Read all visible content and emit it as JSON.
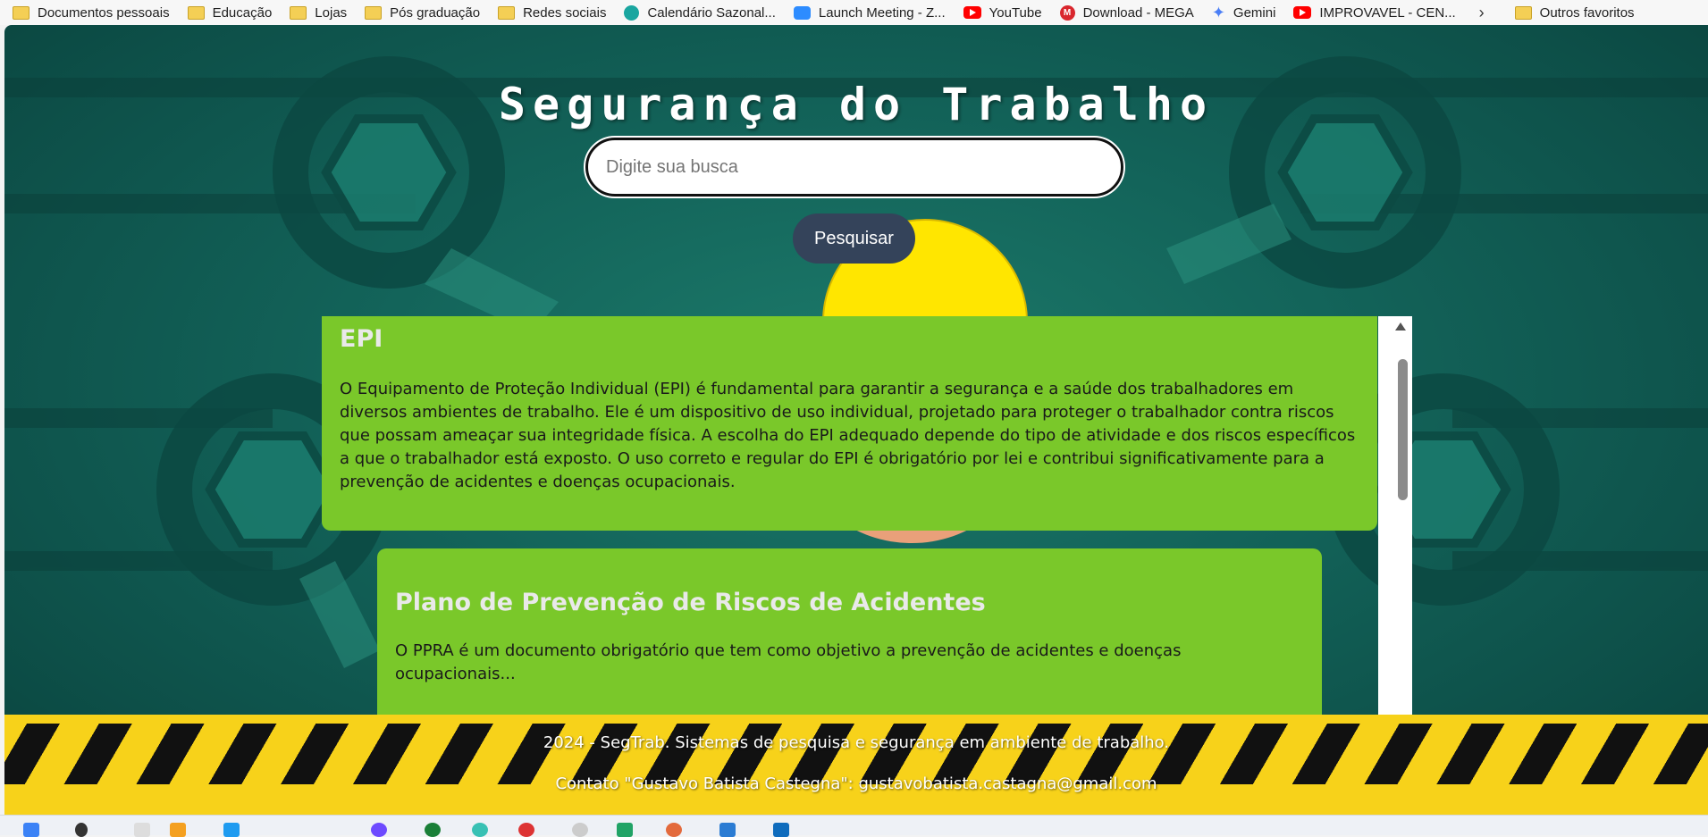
{
  "bookmarks": [
    {
      "label": "Documentos pessoais",
      "icon": "folder-icon"
    },
    {
      "label": "Educação",
      "icon": "folder-icon"
    },
    {
      "label": "Lojas",
      "icon": "folder-icon"
    },
    {
      "label": "Pós graduação",
      "icon": "folder-icon"
    },
    {
      "label": "Redes sociais",
      "icon": "folder-icon"
    },
    {
      "label": "Calendário Sazonal...",
      "icon": "calendar-icon"
    },
    {
      "label": "Launch Meeting - Z...",
      "icon": "zoom-icon"
    },
    {
      "label": "YouTube",
      "icon": "youtube-icon"
    },
    {
      "label": "Download - MEGA",
      "icon": "mega-icon"
    },
    {
      "label": "Gemini",
      "icon": "gemini-icon"
    },
    {
      "label": "IMPROVAVEL - CEN...",
      "icon": "youtube-icon"
    }
  ],
  "bookmarks_more": "Outros favoritos",
  "page": {
    "title": "Segurança do Trabalho",
    "search_placeholder": "Digite sua busca",
    "search_button": "Pesquisar"
  },
  "cards": [
    {
      "title": "EPI",
      "text": "O Equipamento de Proteção Individual (EPI) é fundamental para garantir a segurança e a saúde dos trabalhadores em diversos ambientes de trabalho. Ele é um dispositivo de uso individual, projetado para proteger o trabalhador contra riscos que possam ameaçar sua integridade física. A escolha do EPI adequado depende do tipo de atividade e dos riscos específicos a que o trabalhador está exposto. O uso correto e regular do EPI é obrigatório por lei e contribui significativamente para a prevenção de acidentes e doenças ocupacionais."
    },
    {
      "title": "Plano de Prevenção de Riscos de Acidentes",
      "text": "O PPRA é um documento obrigatório que tem como objetivo a prevenção de acidentes e doenças ocupacionais..."
    }
  ],
  "footer": {
    "line1": "2024 - SegTrab. Sistemas de pesquisa e segurança em ambiente de trabalho.",
    "line2": "Contato \"Gustavo Batista Castegna\": gustavobatista.castagna@gmail.com"
  },
  "colors": {
    "card_bg": "#7ac82a",
    "button_bg": "#34435a",
    "footer_yellow": "#f7d21a"
  }
}
